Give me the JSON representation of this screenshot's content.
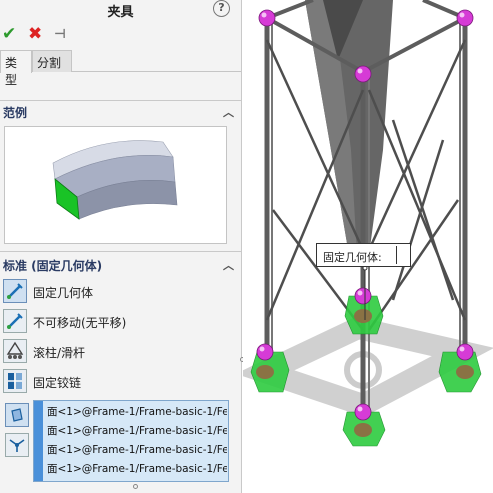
{
  "panel": {
    "title": "夹具",
    "help_glyph": "?",
    "actions": {
      "ok": "✔",
      "cancel": "✖",
      "pin": "⊣"
    },
    "tabs": [
      {
        "label": "类型",
        "active": true
      },
      {
        "label": "分割",
        "active": false
      }
    ],
    "example_section": {
      "title": "范例"
    },
    "standard_section": {
      "title": "标准 (固定几何体)",
      "options": [
        {
          "label": "固定几何体",
          "icon": "fixed-geometry-icon",
          "selected": true
        },
        {
          "label": "不可移动(无平移)",
          "icon": "immovable-icon",
          "selected": false
        },
        {
          "label": "滚柱/滑杆",
          "icon": "roller-slider-icon",
          "selected": false
        },
        {
          "label": "固定铰链",
          "icon": "fixed-hinge-icon",
          "selected": false
        }
      ],
      "side_buttons": [
        {
          "icon": "face-selection-icon"
        },
        {
          "icon": "vertex-selection-icon"
        }
      ],
      "faces": [
        "面<1>@Frame-1/Frame-basic-1/Fe",
        "面<1>@Frame-1/Frame-basic-1/Fe",
        "面<1>@Frame-1/Frame-basic-1/Fe",
        "面<1>@Frame-1/Frame-basic-1/Fe"
      ]
    }
  },
  "viewport": {
    "callout_label": "固定几何体:",
    "colors": {
      "sphere": "#d63bd6",
      "fixture_arrows": "#2ecc40",
      "frame": "#5d5d5d"
    }
  }
}
